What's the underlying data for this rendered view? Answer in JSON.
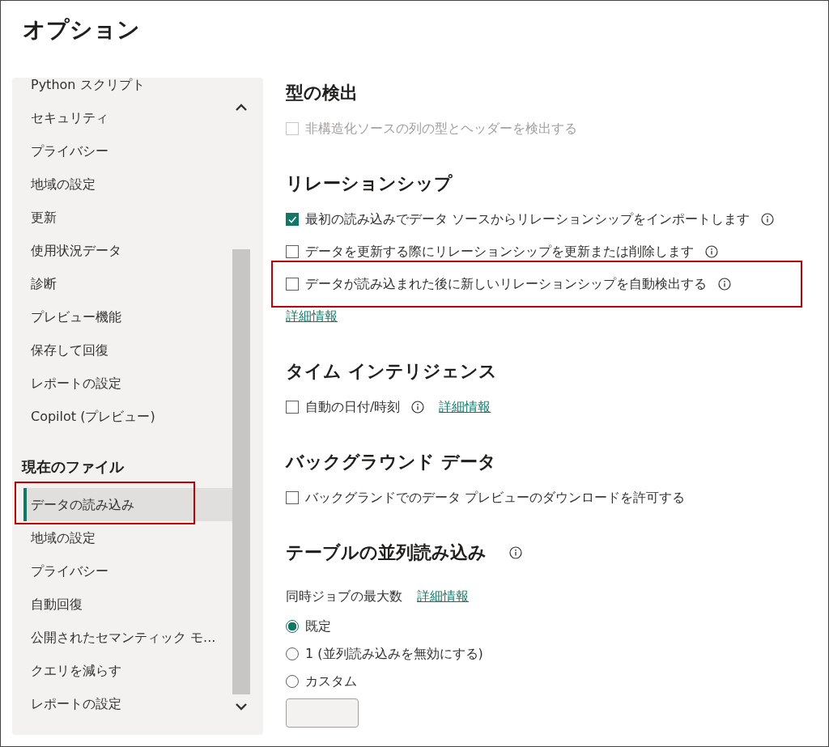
{
  "window": {
    "title": "オプション"
  },
  "sidebar": {
    "groups": [
      {
        "items": [
          {
            "label": "Python スクリプト",
            "selected": false,
            "highlighted": false
          },
          {
            "label": "セキュリティ",
            "selected": false,
            "highlighted": false
          },
          {
            "label": "プライバシー",
            "selected": false,
            "highlighted": false
          },
          {
            "label": "地域の設定",
            "selected": false,
            "highlighted": false
          },
          {
            "label": "更新",
            "selected": false,
            "highlighted": false
          },
          {
            "label": "使用状況データ",
            "selected": false,
            "highlighted": false
          },
          {
            "label": "診断",
            "selected": false,
            "highlighted": false
          },
          {
            "label": "プレビュー機能",
            "selected": false,
            "highlighted": false
          },
          {
            "label": "保存して回復",
            "selected": false,
            "highlighted": false
          },
          {
            "label": "レポートの設定",
            "selected": false,
            "highlighted": false
          },
          {
            "label": "Copilot (プレビュー)",
            "selected": false,
            "highlighted": false
          }
        ]
      },
      {
        "heading": "現在のファイル",
        "items": [
          {
            "label": "データの読み込み",
            "selected": true,
            "highlighted": true
          },
          {
            "label": "地域の設定",
            "selected": false,
            "highlighted": false
          },
          {
            "label": "プライバシー",
            "selected": false,
            "highlighted": false
          },
          {
            "label": "自動回復",
            "selected": false,
            "highlighted": false
          },
          {
            "label": "公開されたセマンティック モ...",
            "selected": false,
            "highlighted": false
          },
          {
            "label": "クエリを減らす",
            "selected": false,
            "highlighted": false
          },
          {
            "label": "レポートの設定",
            "selected": false,
            "highlighted": false
          }
        ]
      }
    ]
  },
  "sections": [
    {
      "heading": "型の検出",
      "rows": [
        {
          "kind": "checkbox",
          "label": "非構造化ソースの列の型とヘッダーを検出する",
          "checked": false,
          "disabled": true
        }
      ]
    },
    {
      "heading": "リレーションシップ",
      "rows": [
        {
          "kind": "checkbox",
          "label": "最初の読み込みでデータ ソースからリレーションシップをインポートします",
          "checked": true,
          "disabled": false,
          "info": true
        },
        {
          "kind": "checkbox",
          "label": "データを更新する際にリレーションシップを更新または削除します",
          "checked": false,
          "disabled": false,
          "info": true
        },
        {
          "kind": "checkbox",
          "label": "データが読み込まれた後に新しいリレーションシップを自動検出する",
          "checked": false,
          "disabled": false,
          "info": true,
          "highlighted": true
        },
        {
          "kind": "link",
          "link": "詳細情報"
        }
      ]
    },
    {
      "heading": "タイム インテリジェンス",
      "rows": [
        {
          "kind": "checkbox",
          "label": "自動の日付/時刻",
          "checked": false,
          "disabled": false,
          "info": true,
          "link": "詳細情報"
        }
      ]
    },
    {
      "heading": "バックグラウンド データ",
      "rows": [
        {
          "kind": "checkbox",
          "label": "バックグランドでのデータ プレビューのダウンロードを許可する",
          "checked": false,
          "disabled": false
        }
      ]
    },
    {
      "heading": "テーブルの並列読み込み",
      "info": true,
      "rows": [
        {
          "kind": "label",
          "label": "同時ジョブの最大数",
          "link": "詳細情報"
        },
        {
          "kind": "radio",
          "label": "既定",
          "selected": true
        },
        {
          "kind": "radio",
          "label": "1 (並列読み込みを無効にする)",
          "selected": false
        },
        {
          "kind": "radio",
          "label": "カスタム",
          "selected": false
        },
        {
          "kind": "field"
        }
      ]
    }
  ]
}
